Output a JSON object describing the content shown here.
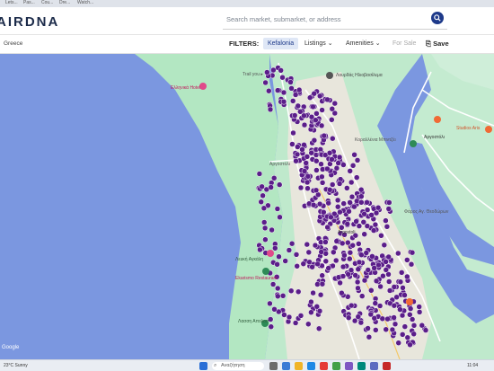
{
  "browser": {
    "tabs": [
      "Lets...",
      "Pas...",
      "Cou...",
      "Dre...",
      "Watch..."
    ]
  },
  "header": {
    "logo": "AIRDNA",
    "search_placeholder": "Search market, submarket, or address",
    "search_icon": "search-icon"
  },
  "subbar": {
    "region": "Greece",
    "filters_label": "FILTERS:",
    "market_chip": "Kefalonia",
    "listings_label": "Listings",
    "amenities_label": "Amenities",
    "forsale_label": "For Sale",
    "save_label": "Save"
  },
  "map": {
    "poi_labels": [
      "Ελληνικά Hotel",
      "Trail you ▸",
      "Λουρδάς Ηλιοβασίλεμα",
      "Αργοστόλι",
      "Κοραλλένια Μπιντζέι",
      "Argostoli",
      "Λευκή Αγκάλη",
      "Ekarismo Restaurant",
      "Λασση Απολοπ",
      "Studios Aris",
      "Αργοστόλι",
      "Φάρος Αγ. Θεοδώρων"
    ],
    "attribution": "Google",
    "colors": {
      "sea": "#7b97e0",
      "land": "#b3e7c2",
      "dot": "#5b1e8a",
      "road": "#ffffff"
    }
  },
  "taskbar": {
    "left_text": "23°C Sunny",
    "search_text": "Αναζήτηση",
    "time": "11:04"
  }
}
